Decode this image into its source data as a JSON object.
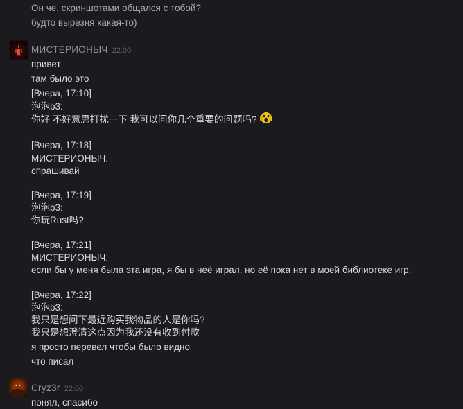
{
  "messages": {
    "top_lines": [
      "Он че, скриншотами общался с тобой?",
      "будто вырезня какая-то)"
    ],
    "mist": {
      "sender": "МИСТЕРИОНЫЧ",
      "time": "22:00",
      "lines": [
        "привет",
        "там было это",
        "[Вчера, 17:10]",
        "泡泡b3:",
        "你好 不好意思打扰一下 我可以问你几个重要的问题吗?",
        "[Вчера, 17:18]",
        "МИСТЕРИОНЫЧ:",
        "спрашивай",
        "[Вчера, 17:19]",
        "泡泡b3:",
        "你玩Rust吗?",
        "[Вчера, 17:21]",
        "МИСТЕРИОНЫЧ:",
        "если бы у меня была эта игра, я бы в неё играл, но её пока нет в моей библиотеке игр.",
        "[Вчера, 17:22]",
        "泡泡b3:",
        "我只是想问下最近购买我物品的人是你吗?",
        "我只是想澄清这点因为我还没有收到付款",
        "я просто перевел чтобы было видно",
        "что писал"
      ]
    },
    "cryz": {
      "sender": "Cryz3r",
      "time": "22:00",
      "lines": [
        "понял, спасибо"
      ]
    }
  },
  "icons": {
    "mist_avatar": "avatar-dark-red-figure-icon",
    "cryz_avatar": "avatar-orange-portrait-icon",
    "emoji": "screaming-face-emoji-icon"
  },
  "colors": {
    "background": "#1b1b1f",
    "text": "#d7d9dc",
    "sender": "#8f98a0",
    "timestamp": "#5c6167"
  }
}
